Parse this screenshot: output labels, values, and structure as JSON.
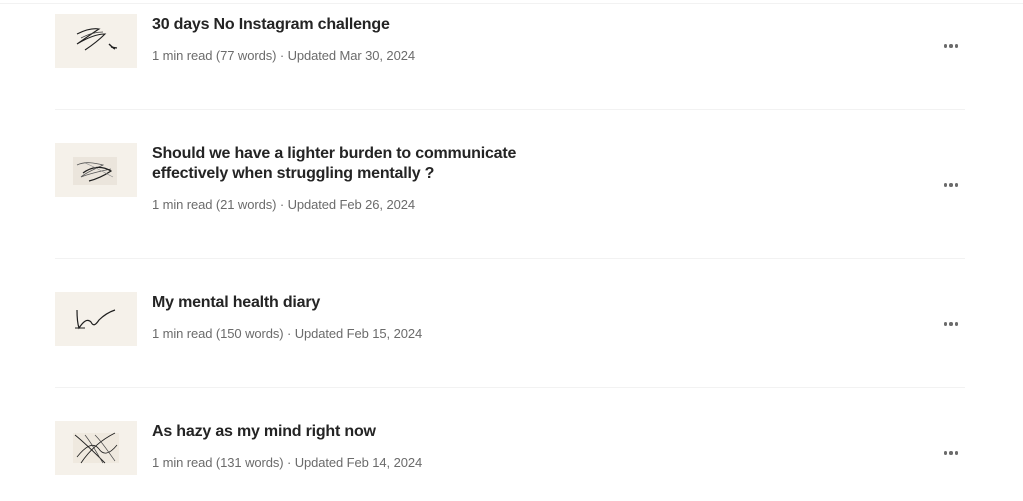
{
  "stories": [
    {
      "title": "30 days No Instagram challenge",
      "meta": "1 min read (77 words) · Updated Mar 30, 2024",
      "thumbnail_icon": "scribble-thumbnail-1",
      "more_icon": "more-options-icon"
    },
    {
      "title": "Should we have a lighter burden to communicate effectively when struggling mentally ?",
      "meta": "1 min read (21 words) · Updated Feb 26, 2024",
      "thumbnail_icon": "scribble-thumbnail-2",
      "more_icon": "more-options-icon"
    },
    {
      "title": "My mental health diary",
      "meta": "1 min read (150 words) · Updated Feb 15, 2024",
      "thumbnail_icon": "scribble-thumbnail-3",
      "more_icon": "more-options-icon"
    },
    {
      "title": "As hazy as my mind right now",
      "meta": "1 min read (131 words) · Updated Feb 14, 2024",
      "thumbnail_icon": "scribble-thumbnail-4",
      "more_icon": "more-options-icon"
    }
  ],
  "colors": {
    "title": "#242424",
    "meta": "#6b6b6b",
    "thumbnail_bg": "#f5f1ea",
    "divider": "#f2f2f2"
  }
}
